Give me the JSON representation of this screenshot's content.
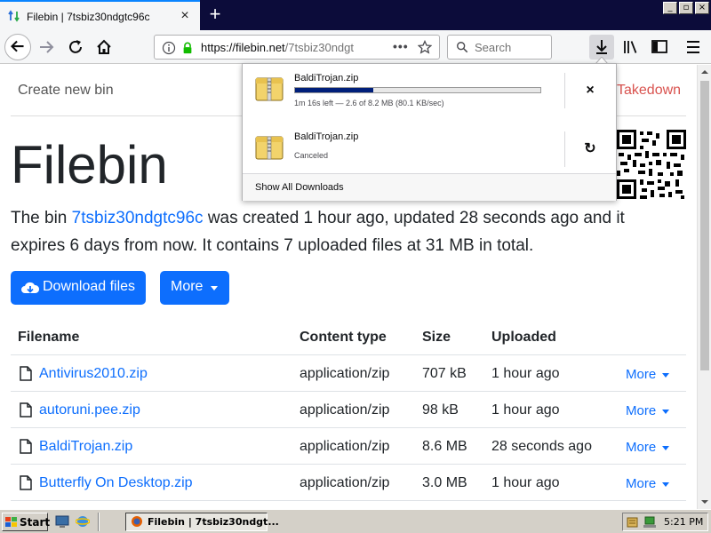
{
  "browser": {
    "tab_title": "Filebin | 7tsbiz30ndgtc96c",
    "url_host": "https://filebin.net",
    "url_path": "/7tsbiz30ndgt",
    "search_placeholder": "Search",
    "window_controls": [
      "_",
      "▫",
      "×"
    ]
  },
  "downloads_panel": {
    "items": [
      {
        "name": "BaldiTrojan.zip",
        "status": "1m 16s left — 2.6 of 8.2 MB (80.1 KB/sec)",
        "progress": 0.32,
        "action": "×"
      },
      {
        "name": "BaldiTrojan.zip",
        "status": "Canceled",
        "action": "↻"
      }
    ],
    "show_all": "Show All Downloads"
  },
  "page": {
    "create_new_bin": "Create new bin",
    "takedown": "Takedown",
    "title": "Filebin",
    "summary_prefix": "The bin ",
    "bin_id": "7tsbiz30ndgtc96c",
    "summary_suffix": " was created 1 hour ago, updated 28 seconds ago and it expires 6 days from now. It contains 7 uploaded files at 31 MB in total.",
    "download_files_label": "Download files",
    "more_label": "More"
  },
  "table": {
    "headers": [
      "Filename",
      "Content type",
      "Size",
      "Uploaded"
    ],
    "rows": [
      {
        "filename": "Antivirus2010.zip",
        "type": "application/zip",
        "size": "707 kB",
        "uploaded": "1 hour ago",
        "more": "More"
      },
      {
        "filename": "autoruni.pee.zip",
        "type": "application/zip",
        "size": "98 kB",
        "uploaded": "1 hour ago",
        "more": "More"
      },
      {
        "filename": "BaldiTrojan.zip",
        "type": "application/zip",
        "size": "8.6 MB",
        "uploaded": "28 seconds ago",
        "more": "More"
      },
      {
        "filename": "Butterfly On Desktop.zip",
        "type": "application/zip",
        "size": "3.0 MB",
        "uploaded": "1 hour ago",
        "more": "More"
      }
    ]
  },
  "taskbar": {
    "start_label": "Start",
    "task_label": "Filebin | 7tsbiz30ndgt...",
    "clock": "5:21 PM"
  },
  "colors": {
    "accent": "#0d6efd",
    "link": "#0d6efd",
    "takedown": "#d9534f",
    "tabstrip": "#0c0c3a"
  }
}
